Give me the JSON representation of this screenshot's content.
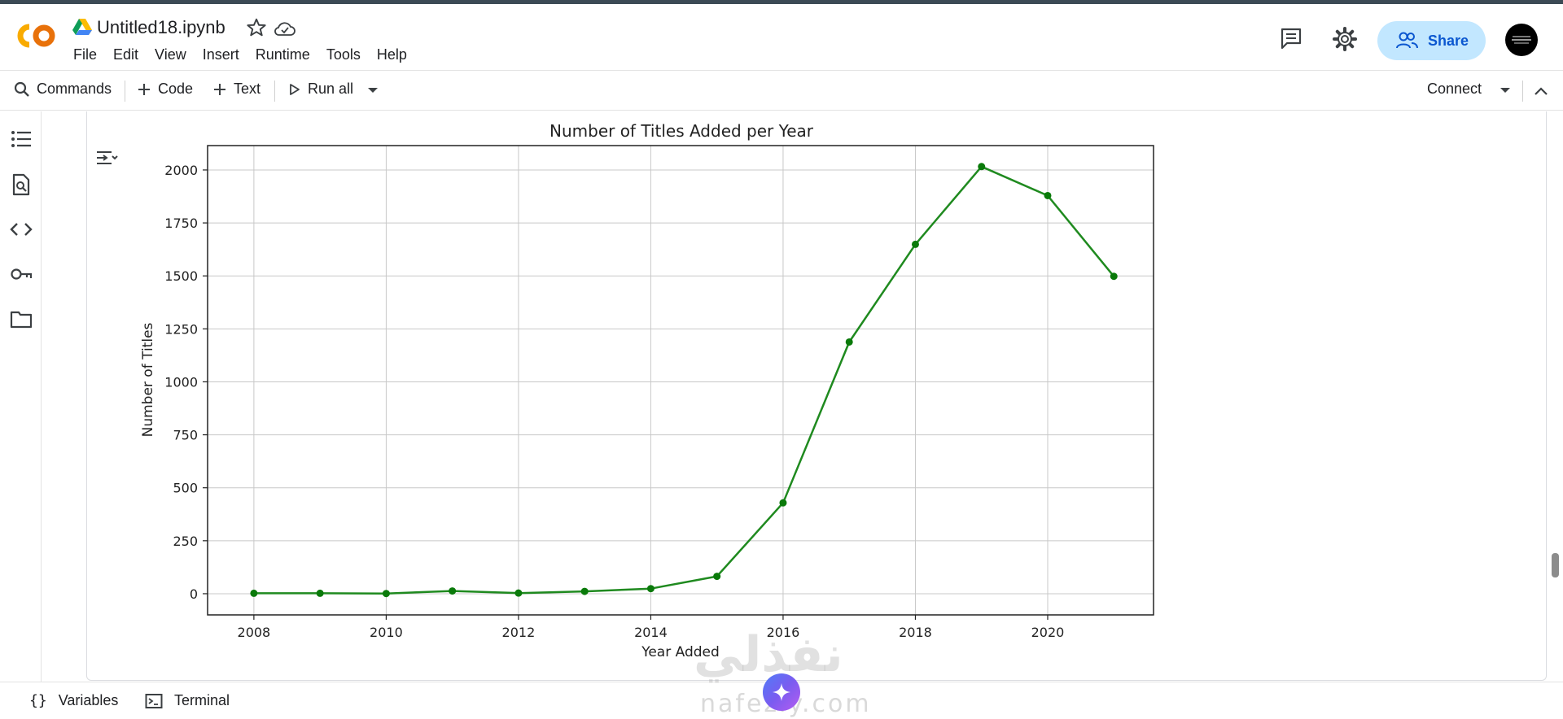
{
  "header": {
    "notebook_title": "Untitled18.ipynb",
    "menu": [
      "File",
      "Edit",
      "View",
      "Insert",
      "Runtime",
      "Tools",
      "Help"
    ],
    "share_label": "Share"
  },
  "toolbar": {
    "commands_label": "Commands",
    "code_label": "Code",
    "text_label": "Text",
    "run_all_label": "Run all",
    "connect_label": "Connect"
  },
  "statusbar": {
    "variables_label": "Variables",
    "terminal_label": "Terminal"
  },
  "watermark": {
    "arabic": "نفذلي",
    "latin": "nafezly.com"
  },
  "colors": {
    "line": "#1f8a1f",
    "marker": "#0a7a0a",
    "share_bg": "#c2e7ff",
    "share_text": "#0b57d0",
    "grid": "#c8c8c8"
  },
  "chart_data": {
    "type": "line",
    "title": "Number of Titles Added per Year",
    "xlabel": "Year Added",
    "ylabel": "Number of Titles",
    "x": [
      2008,
      2009,
      2010,
      2011,
      2012,
      2013,
      2014,
      2015,
      2016,
      2017,
      2018,
      2019,
      2020,
      2021
    ],
    "y": [
      2,
      2,
      1,
      13,
      3,
      11,
      24,
      82,
      429,
      1188,
      1649,
      2016,
      1879,
      1498
    ],
    "xlim": [
      2007.3,
      2021.6
    ],
    "ylim": [
      -100,
      2115
    ],
    "xticks": [
      2008,
      2010,
      2012,
      2014,
      2016,
      2018,
      2020
    ],
    "yticks": [
      0,
      250,
      500,
      750,
      1000,
      1250,
      1500,
      1750,
      2000
    ],
    "grid": true,
    "marker": "circle"
  }
}
